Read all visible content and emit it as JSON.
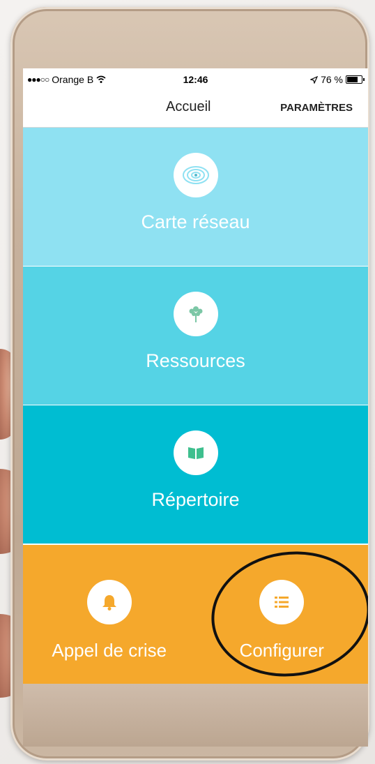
{
  "statusbar": {
    "carrier": "Orange B",
    "time": "12:46",
    "battery": "76 %"
  },
  "navbar": {
    "title": "Accueil",
    "settings_label": "PARAMÈTRES"
  },
  "tiles": [
    {
      "label": "Carte réseau",
      "icon": "network-map-icon",
      "color": "#8fe1f2"
    },
    {
      "label": "Ressources",
      "icon": "tree-icon",
      "color": "#55d3e5"
    },
    {
      "label": "Répertoire",
      "icon": "book-icon",
      "color": "#00bdd2"
    }
  ],
  "bottom_tiles": [
    {
      "label": "Appel de crise",
      "icon": "bell-icon"
    },
    {
      "label": "Configurer",
      "icon": "list-icon"
    }
  ],
  "colors": {
    "accent_orange": "#f5a82c",
    "circle_icon": "#54c8dc"
  }
}
